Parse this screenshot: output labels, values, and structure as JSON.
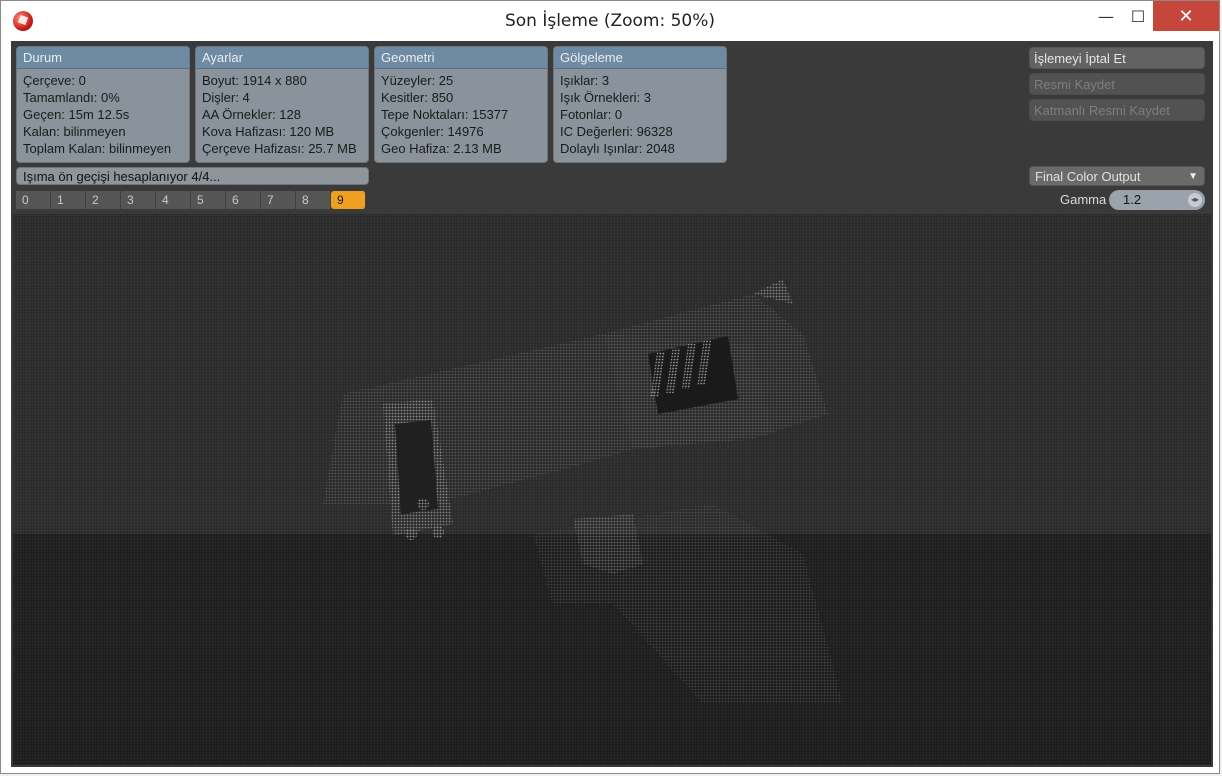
{
  "window": {
    "title": "Son İşleme (Zoom: 50%)",
    "minimize": "—",
    "maximize": "☐",
    "close": "✕"
  },
  "panels": {
    "durum": {
      "title": "Durum",
      "lines": [
        "Çerçeve: 0",
        "Tamamlandı: 0%",
        "Geçen: 15m 12.5s",
        "Kalan: bilinmeyen",
        "Toplam Kalan: bilinmeyen"
      ]
    },
    "ayarlar": {
      "title": "Ayarlar",
      "lines": [
        "Boyut: 1914 x 880",
        "Dişler: 4",
        "AA Örnekler: 128",
        "Kova Hafizası: 120 MB",
        "Çerçeve Hafizası: 25.7 MB"
      ]
    },
    "geometri": {
      "title": "Geometri",
      "lines": [
        "Yüzeyler: 25",
        "Kesitler: 850",
        "Tepe Noktaları: 15377",
        "Çokgenler: 14976",
        "Geo Hafiza: 2.13 MB"
      ]
    },
    "golgeleme": {
      "title": "Gölgeleme",
      "lines": [
        "Işıklar: 3",
        "Işık Örnekleri: 3",
        "Fotonlar: 0",
        "IC Değerleri: 96328",
        "Dolaylı Işınlar: 2048"
      ]
    }
  },
  "actions": {
    "cancel": "İşlemeyi İptal Et",
    "save_image": "Resmi Kaydet",
    "save_layered": "Katmanlı Resmi Kaydet"
  },
  "status_text": "Işıma ön geçişi hesaplanıyor 4/4...",
  "passes": [
    "0",
    "1",
    "2",
    "3",
    "4",
    "5",
    "6",
    "7",
    "8",
    "9"
  ],
  "active_pass": "9",
  "output": {
    "selected": "Final Color Output",
    "gamma_label": "Gamma",
    "gamma_value": "1.2"
  },
  "colors": {
    "accent": "#f0a020",
    "panel_header": "#6f8aa3",
    "close_button": "#c7463b"
  }
}
